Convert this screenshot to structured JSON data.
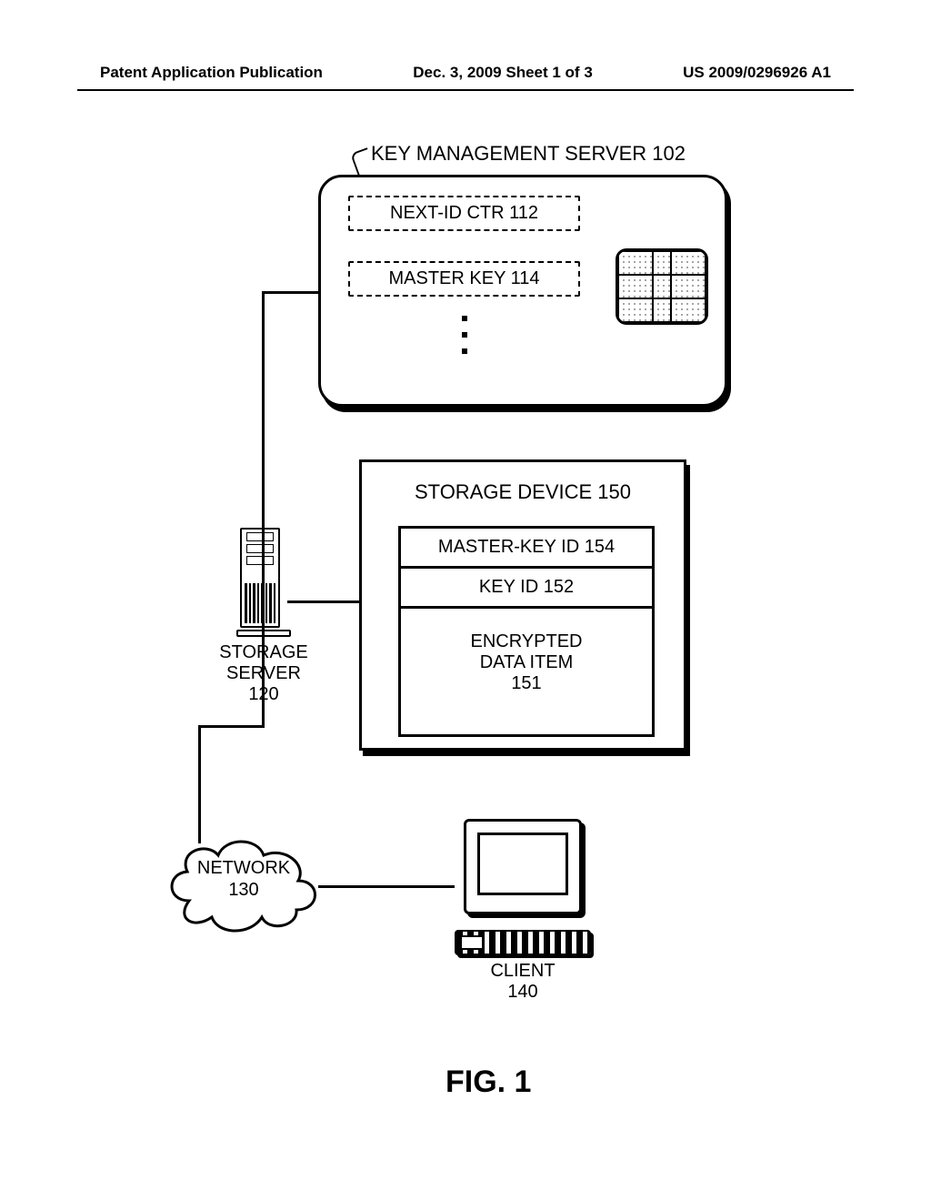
{
  "header": {
    "left": "Patent Application Publication",
    "center": "Dec. 3, 2009  Sheet 1 of 3",
    "right": "US 2009/0296926 A1"
  },
  "kms": {
    "title": "KEY MANAGEMENT SERVER 102",
    "next_id": "NEXT-ID CTR   112",
    "master_key": "MASTER KEY   114"
  },
  "storage_device": {
    "title": "STORAGE DEVICE 150",
    "mk_id": "MASTER-KEY ID 154",
    "key_id": "KEY ID 152",
    "data_item": "ENCRYPTED\nDATA ITEM\n151"
  },
  "storage_server": {
    "label": "STORAGE\nSERVER\n120"
  },
  "network": {
    "label": "NETWORK\n130"
  },
  "client": {
    "label": "CLIENT\n140"
  },
  "figure_label": "FIG. 1"
}
